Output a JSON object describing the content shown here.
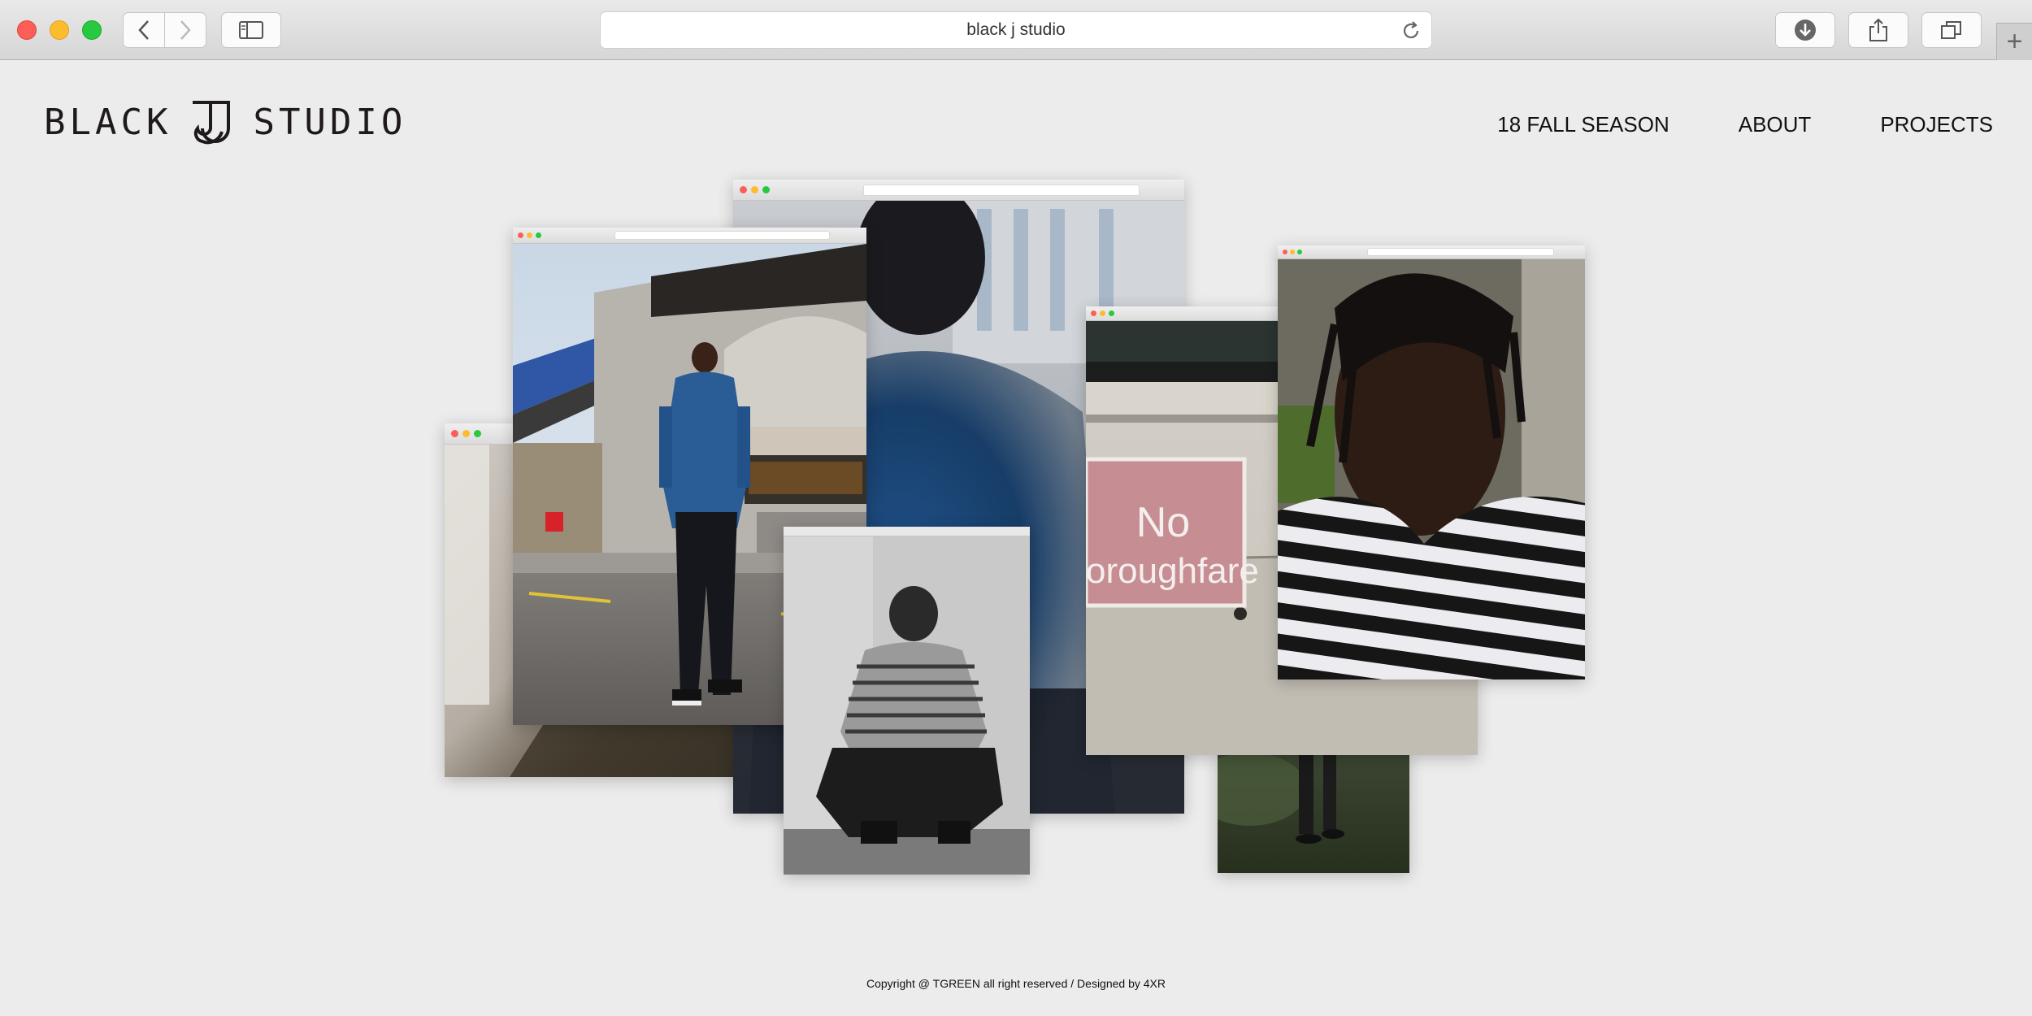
{
  "browser": {
    "url_text": "black j studio",
    "icons": {
      "back": "chevron-left-icon",
      "forward": "chevron-right-icon",
      "sidebar": "sidebar-icon",
      "reload": "reload-icon",
      "download": "download-icon",
      "share": "share-icon",
      "tabs": "tabs-icon",
      "new_tab": "plus-icon"
    },
    "new_tab_glyph": "+"
  },
  "site": {
    "logo_left": "BLACK",
    "logo_right": "STUDIO",
    "nav": [
      "18 FALL SEASON",
      "ABOUT",
      "PROJECTS"
    ],
    "footer": "Copyright @ TGREEN all right reserved / Designed by 4XR"
  },
  "gallery": {
    "photos": [
      {
        "name": "photo-left-blurred",
        "subject": "blurred street detail"
      },
      {
        "name": "photo-center-blurred",
        "subject": "blurred figure in blue jacket"
      },
      {
        "name": "photo-street",
        "subject": "man in blue jacket standing in street"
      },
      {
        "name": "photo-crouch",
        "subject": "black and white crouching portrait"
      },
      {
        "name": "photo-grass",
        "subject": "feet on grass"
      },
      {
        "name": "photo-sign",
        "subject": "No Thoroughfare sign on wall",
        "sign_line1": "No",
        "sign_line2": "oroughfare"
      },
      {
        "name": "photo-stripe",
        "subject": "portrait in striped shirt"
      }
    ]
  },
  "colors": {
    "page_bg": "#ececec",
    "accent_blue": "#2a5c96",
    "text": "#111111"
  }
}
